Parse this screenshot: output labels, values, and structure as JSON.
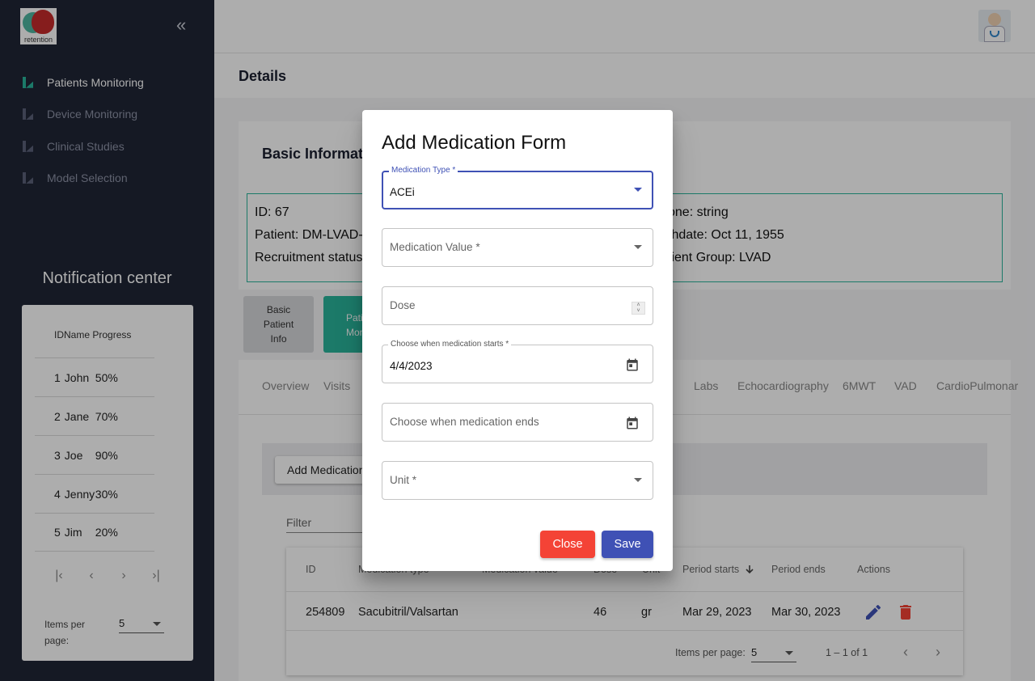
{
  "app": {
    "logo_text": "retention",
    "collapse_icon": "double-chevron-left-icon",
    "accent_color": "#2ab49b",
    "primary_color": "#3f51b5",
    "danger_color": "#f44336"
  },
  "sidebar": {
    "items": [
      {
        "label": "Patients Monitoring",
        "active": true
      },
      {
        "label": "Device Monitoring",
        "active": false
      },
      {
        "label": "Clinical Studies",
        "active": false
      },
      {
        "label": "Model Selection",
        "active": false
      }
    ]
  },
  "notifications": {
    "title": "Notification center",
    "header": "IDName Progress",
    "rows": [
      {
        "id": "1",
        "name": "John",
        "progress": "50%"
      },
      {
        "id": "2",
        "name": "Jane",
        "progress": "70%"
      },
      {
        "id": "3",
        "name": "Joe",
        "progress": "90%"
      },
      {
        "id": "4",
        "name": "Jenny",
        "progress": "30%"
      },
      {
        "id": "5",
        "name": "Jim",
        "progress": "20%"
      }
    ],
    "items_per_page_label": "Items per page:",
    "items_per_page_value": "5"
  },
  "page": {
    "title": "Details",
    "basic_info_title": "Basic Information",
    "info": {
      "id": "ID: 67",
      "patient": "Patient: DM-LVAD-",
      "recruitment": "Recruitment status",
      "phone": "one: string",
      "birthdate": "thdate: Oct 11, 1955",
      "group": "tient Group: LVAD"
    },
    "side_tabs": [
      "Basic Patient Info",
      "Pati Monito"
    ],
    "tabs": [
      "Overview",
      "Visits",
      "Labs",
      "Echocardiography",
      "6MWT",
      "VAD",
      "CardioPulmonar"
    ],
    "add_medication_label": "Add Medication",
    "filter_label": "Filter"
  },
  "table": {
    "headers": [
      "ID",
      "Medication type",
      "Medication value",
      "Dose",
      "Unit",
      "Period starts",
      "Period ends",
      "Actions"
    ],
    "rows": [
      {
        "id": "254809",
        "type": "Sacubitril/Valsartan",
        "value": "",
        "dose": "46",
        "unit": "gr",
        "start": "Mar 29, 2023",
        "end": "Mar 30, 2023"
      }
    ],
    "items_per_page_label": "Items per page:",
    "items_per_page_value": "5",
    "range_label": "1 – 1 of 1"
  },
  "dialog": {
    "title": "Add Medication Form",
    "medication_type_label": "Medication Type *",
    "medication_type_value": "ACEi",
    "medication_value_placeholder": "Medication Value *",
    "dose_placeholder": "Dose",
    "start_label": "Choose when medication starts *",
    "start_value": "4/4/2023",
    "end_placeholder": "Choose when medication ends",
    "unit_placeholder": "Unit *",
    "close_label": "Close",
    "save_label": "Save"
  }
}
